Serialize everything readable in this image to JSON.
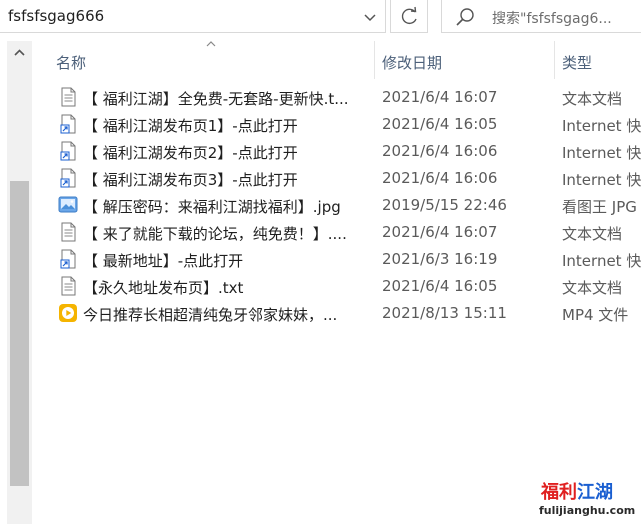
{
  "address_bar": {
    "path": "fsfsfsgag666"
  },
  "search": {
    "placeholder": "搜索\"fsfsfsgag6..."
  },
  "columns": {
    "name": "名称",
    "date": "修改日期",
    "type": "类型"
  },
  "files": [
    {
      "name": "【 福利江湖】全免费-无套路-更新快.t...",
      "date": "2021/6/4 16:07",
      "type": "文本文档",
      "icon": "text-file-icon"
    },
    {
      "name": "【 福利江湖发布页1】-点此打开",
      "date": "2021/6/4 16:05",
      "type": "Internet 快",
      "icon": "internet-shortcut-icon"
    },
    {
      "name": "【 福利江湖发布页2】-点此打开",
      "date": "2021/6/4 16:06",
      "type": "Internet 快",
      "icon": "internet-shortcut-icon"
    },
    {
      "name": "【 福利江湖发布页3】-点此打开",
      "date": "2021/6/4 16:06",
      "type": "Internet 快",
      "icon": "internet-shortcut-icon"
    },
    {
      "name": "【 解压密码：来福利江湖找福利】.jpg",
      "date": "2019/5/15 22:46",
      "type": "看图王 JPG",
      "icon": "image-file-icon"
    },
    {
      "name": "【 来了就能下载的论坛，纯免费！】....",
      "date": "2021/6/4 16:07",
      "type": "文本文档",
      "icon": "text-file-icon"
    },
    {
      "name": "【 最新地址】-点此打开",
      "date": "2021/6/3 16:19",
      "type": "Internet 快",
      "icon": "internet-shortcut-icon"
    },
    {
      "name": "【永久地址发布页】.txt",
      "date": "2021/6/4 16:05",
      "type": "文本文档",
      "icon": "text-file-icon"
    },
    {
      "name": "今日推荐长相超清纯兔牙邻家妹妹，...",
      "date": "2021/8/13 15:11",
      "type": "MP4 文件",
      "icon": "video-file-icon"
    }
  ],
  "watermark": {
    "part1": "福利",
    "part2": "江湖",
    "url": "fulijianghu.com"
  },
  "colors": {
    "header_text": "#4c607a",
    "scroll_thumb": "#c2c2c2",
    "video_icon": "#f5b400",
    "wm_red": "#e02020",
    "wm_blue": "#1a5fd1"
  }
}
